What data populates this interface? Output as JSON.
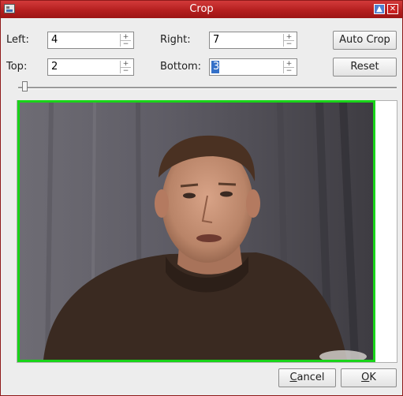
{
  "window": {
    "title": "Crop",
    "icon": "window-icon",
    "maximize_glyph": "▲",
    "close_glyph": "✕"
  },
  "crop": {
    "left": {
      "label": "Left:",
      "value": "4"
    },
    "right": {
      "label": "Right:",
      "value": "7"
    },
    "top": {
      "label": "Top:",
      "value": "2"
    },
    "bottom": {
      "label": "Bottom:",
      "value": "3"
    }
  },
  "buttons": {
    "auto_crop": "Auto Crop",
    "reset": "Reset",
    "cancel_mnemonic": "C",
    "cancel_rest": "ancel",
    "ok_mnemonic": "O",
    "ok_rest": "K"
  },
  "slider": {
    "position": 0.0
  },
  "colors": {
    "titlebar": "#b51f1f",
    "crop_border": "#19d419",
    "selection": "#3470c8"
  },
  "preview": {
    "image": "webcam-photo-of-man"
  }
}
